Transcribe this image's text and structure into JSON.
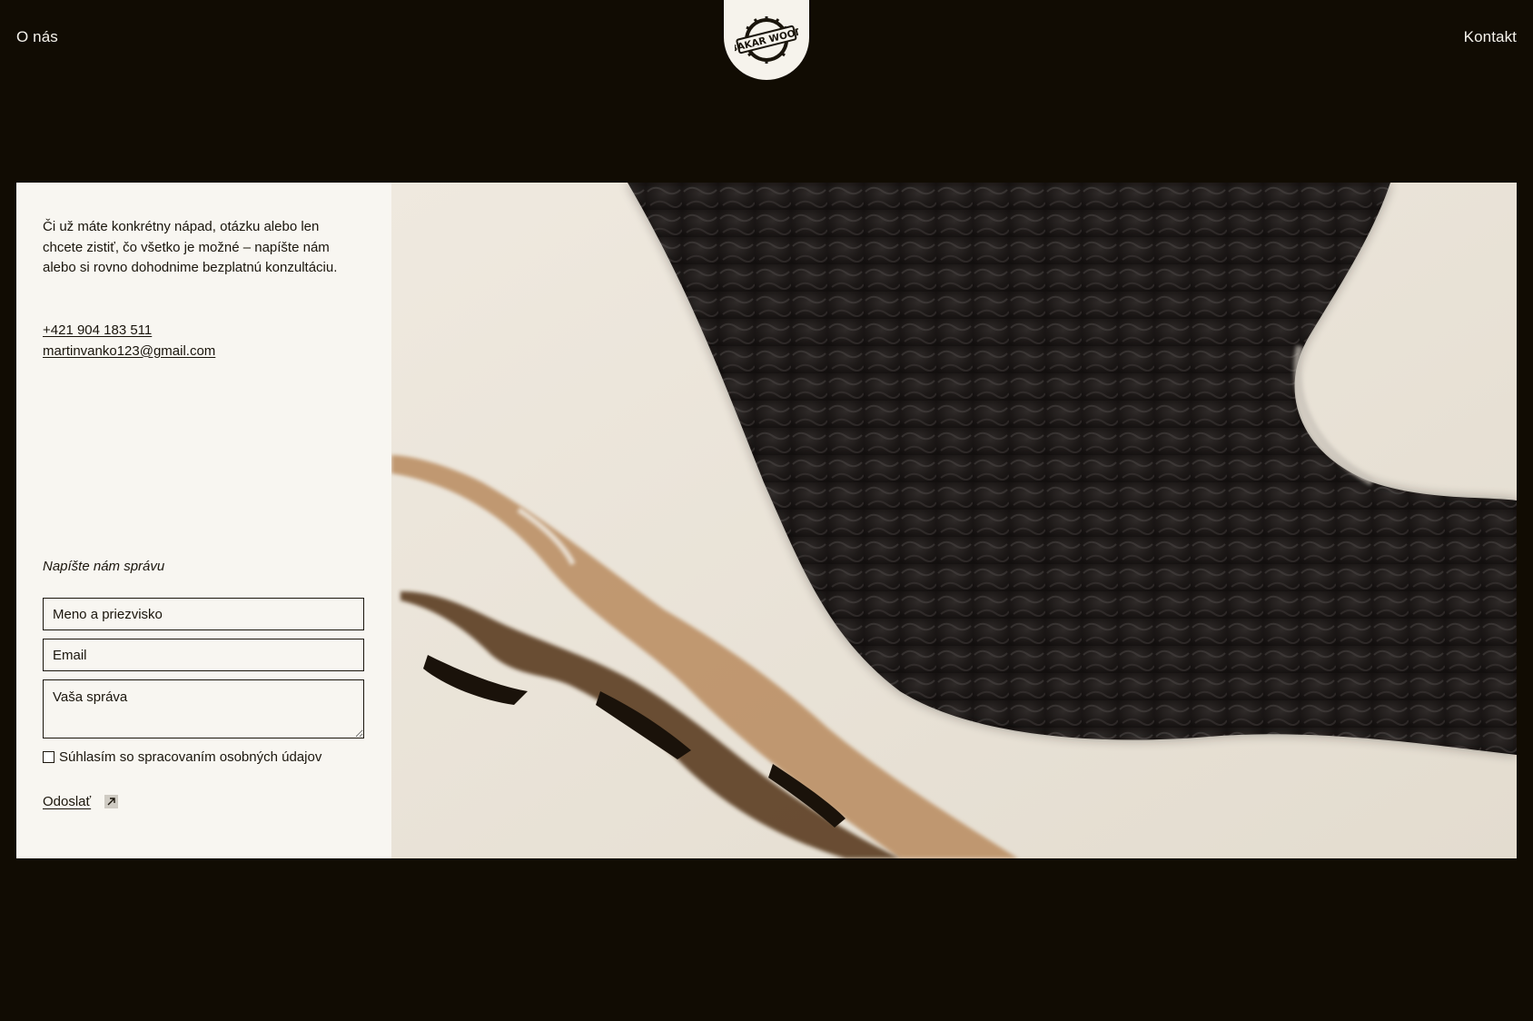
{
  "nav": {
    "about": "O nás",
    "contact": "Kontakt"
  },
  "logo": {
    "text": "BAKAR WOOD",
    "icon": "saw-blade-logo-icon"
  },
  "contact_section": {
    "intro": "Či už máte konkrétny nápad, otázku alebo len chcete zistiť, čo všetko je možné – napíšte nám alebo si rovno dohodnime bezplatnú konzultáciu.",
    "phone": "+421 904 183 511",
    "email": "martinvanko123@gmail.com"
  },
  "form": {
    "title": "Napíšte nám správu",
    "name_placeholder": "Meno a priezvisko",
    "email_placeholder": "Email",
    "message_placeholder": "Vaša správa",
    "consent_label": "Súhlasím so spracovaním osobných údajov",
    "submit_label": "Odoslať",
    "submit_icon": "arrow-up-right-icon"
  },
  "photo": {
    "subject": "epoxy-resin-wood-table-closeup"
  },
  "colors": {
    "background": "#110c03",
    "card": "#f8f6f1",
    "text_dark": "#1a150c",
    "text_light": "#f6f3ec"
  }
}
